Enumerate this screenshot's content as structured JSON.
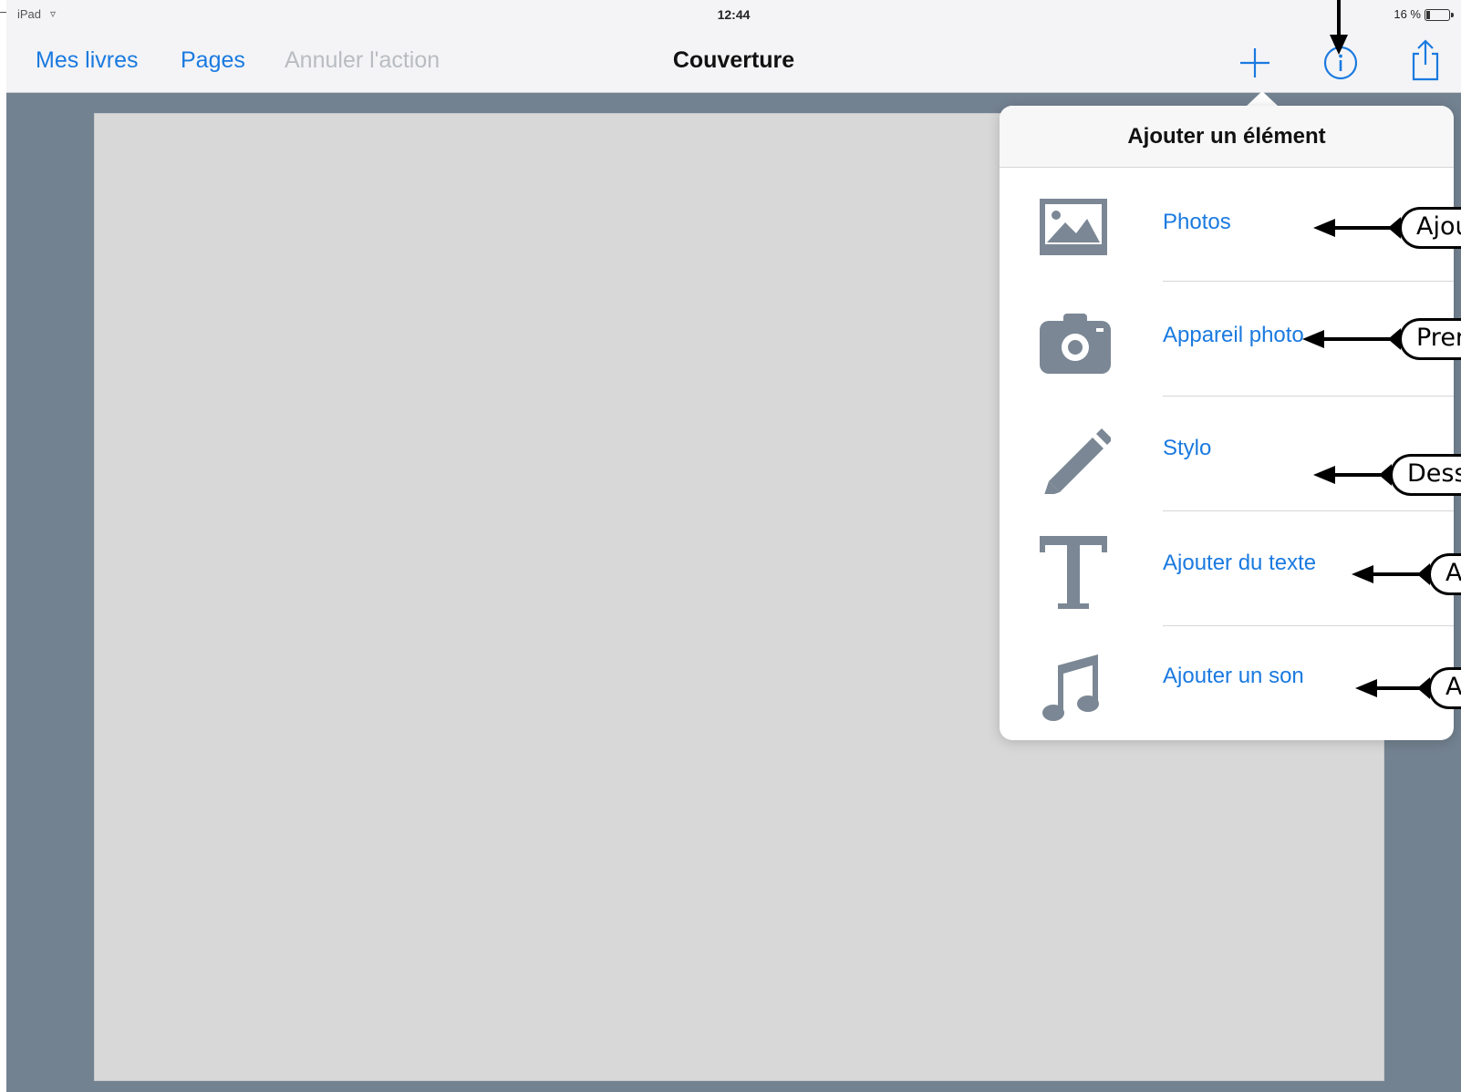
{
  "status_bar": {
    "device": "iPad",
    "time": "12:44",
    "battery": "16 %",
    "battery_level": 0.16
  },
  "nav": {
    "my_books": "Mes livres",
    "pages": "Pages",
    "undo": "Annuler l'action",
    "title": "Couverture"
  },
  "toolbar_icons": [
    "plus-icon",
    "info-icon",
    "share-icon"
  ],
  "popover": {
    "title": "Ajouter un élément",
    "items": [
      {
        "label": "Photos",
        "icon": "photos-icon"
      },
      {
        "label": "Appareil photo",
        "icon": "camera-icon"
      },
      {
        "label": "Stylo",
        "icon": "pen-icon"
      },
      {
        "label": "Ajouter du texte",
        "icon": "text-icon"
      },
      {
        "label": "Ajouter un son",
        "icon": "music-note-icon"
      }
    ]
  },
  "callouts": [
    "Ajou",
    "Pren",
    "Dess",
    "A",
    "A"
  ],
  "colors": {
    "accent": "#1a7ae0",
    "background": "#738291",
    "page": "#d8d8d8",
    "icon_gray": "#7b8794",
    "disabled": "#b9bcc1"
  }
}
